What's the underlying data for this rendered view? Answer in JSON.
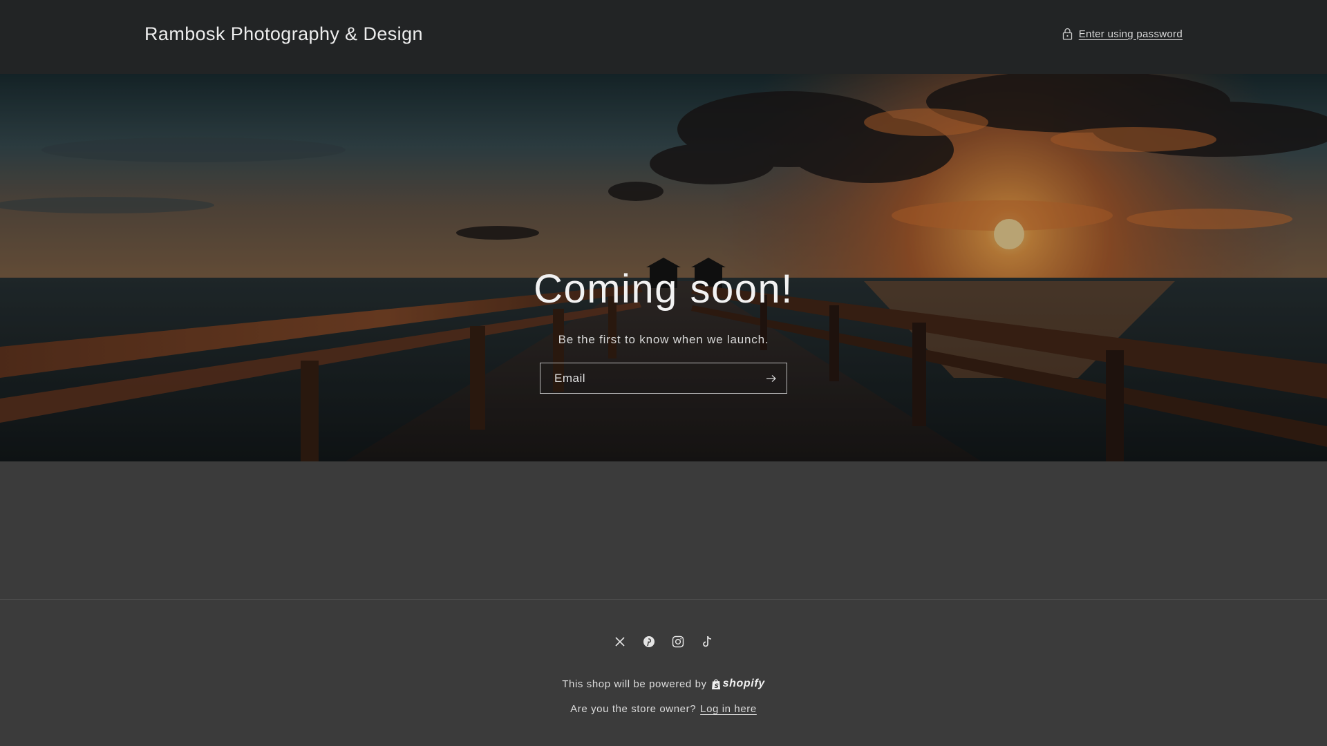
{
  "header": {
    "store_title": "Rambosk Photography & Design",
    "password_link_label": "Enter using password",
    "lock_icon": "lock-icon"
  },
  "hero": {
    "heading": "Coming soon!",
    "subheading": "Be the first to know when we launch.",
    "email_placeholder": "Email",
    "submit_icon": "arrow-right-icon"
  },
  "footer": {
    "social_icons": [
      "x-twitter-icon",
      "pinterest-icon",
      "instagram-icon",
      "tiktok-icon"
    ],
    "powered_text": "This shop will be powered by",
    "shopify_label": "shopify",
    "owner_question": "Are you the store owner?",
    "login_link": "Log in here"
  },
  "colors": {
    "header_bg": "#222425",
    "page_bg": "#3b3b3b",
    "text": "#e8e8e8",
    "sunset_orange": "#e8822f"
  }
}
